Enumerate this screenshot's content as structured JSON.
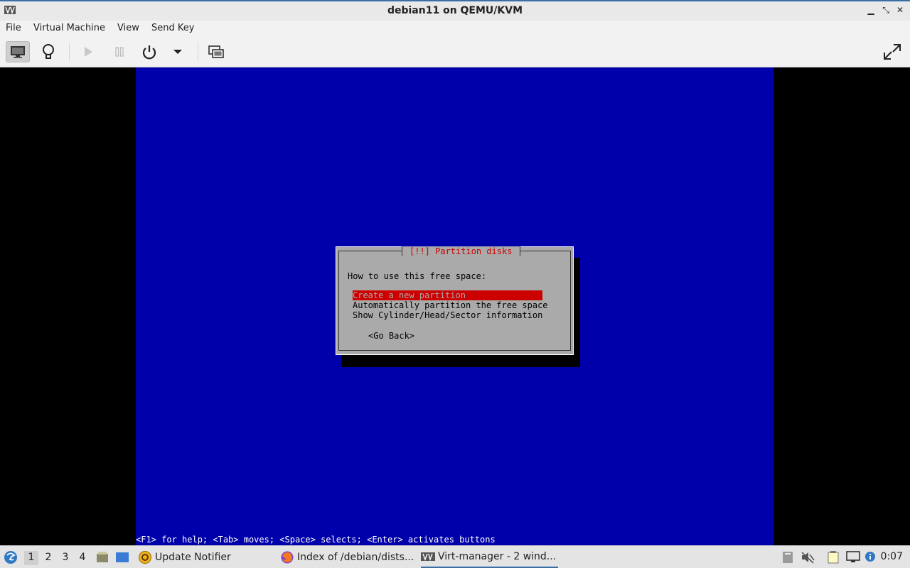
{
  "window": {
    "title": "debian11 on QEMU/KVM",
    "minimize": "▁",
    "restore": "⤡",
    "close": "✕"
  },
  "menu": [
    "File",
    "Virtual Machine",
    "View",
    "Send Key"
  ],
  "toolbar": {
    "icons": [
      "console-icon",
      "details-lightbulb-icon",
      "run-icon",
      "pause-icon",
      "power-icon",
      "power-menu-arrow-icon",
      "snapshots-icon",
      "fullscreen-icon"
    ]
  },
  "installer": {
    "dialog_title": "[!!] Partition disks",
    "prompt": "How to use this free space:",
    "options": [
      "Create a new partition",
      "Automatically partition the free space",
      "Show Cylinder/Head/Sector information"
    ],
    "selected_index": 0,
    "go_back": "<Go Back>",
    "help_line": "<F1> for help; <Tab> moves; <Space> selects; <Enter> activates buttons"
  },
  "taskbar": {
    "workspaces": [
      "1",
      "2",
      "3",
      "4"
    ],
    "current_workspace": "1",
    "tasks": [
      {
        "label": "Update Notifier",
        "icon": "update-notifier-icon"
      },
      {
        "label": "Index of /debian/dists...",
        "icon": "firefox-icon"
      },
      {
        "label": "Virt-manager - 2 wind...",
        "icon": "virt-manager-icon"
      }
    ],
    "clock": "0:07"
  }
}
